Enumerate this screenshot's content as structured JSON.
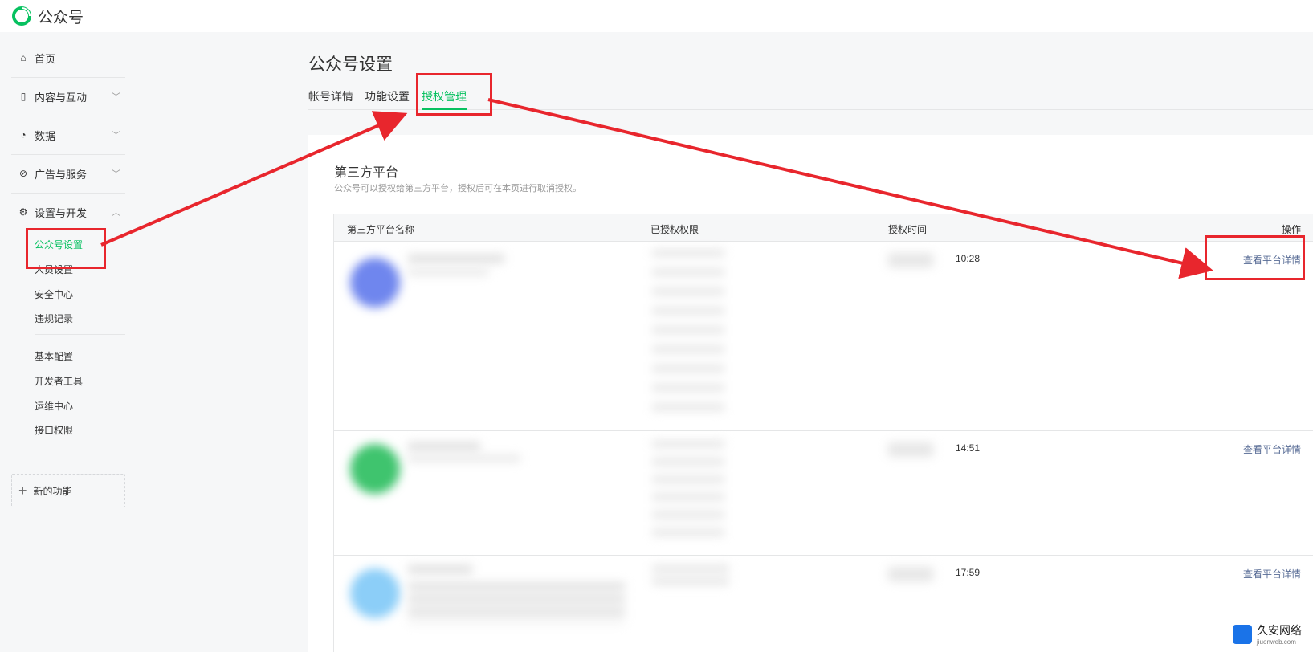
{
  "app": {
    "brand": "公众号"
  },
  "sidebar": {
    "home": "首页",
    "content": "内容与互动",
    "data": "数据",
    "ads": "广告与服务",
    "settings": "设置与开发",
    "settings_sub": [
      "公众号设置",
      "人员设置",
      "安全中心",
      "违规记录"
    ],
    "dev_sub": [
      "基本配置",
      "开发者工具",
      "运维中心",
      "接口权限"
    ],
    "new_feature": "新的功能"
  },
  "main": {
    "title": "公众号设置",
    "tabs": [
      "帐号详情",
      "功能设置",
      "授权管理"
    ],
    "active_tab": "授权管理",
    "section_title": "第三方平台",
    "section_desc": "公众号可以授权给第三方平台，授权后可在本页进行取消授权。",
    "table": {
      "headers": [
        "第三方平台名称",
        "已授权权限",
        "授权时间",
        "操作"
      ],
      "rows": [
        {
          "time": "10:28",
          "action": "查看平台详情"
        },
        {
          "time": "14:51",
          "action": "查看平台详情"
        },
        {
          "time": "17:59",
          "action": "查看平台详情"
        }
      ]
    }
  },
  "watermark": {
    "name": "久安网络",
    "domain": "jiuonweb.com"
  },
  "colors": {
    "accent": "#07c160",
    "link": "#576b95",
    "annotation": "#e8262d"
  }
}
